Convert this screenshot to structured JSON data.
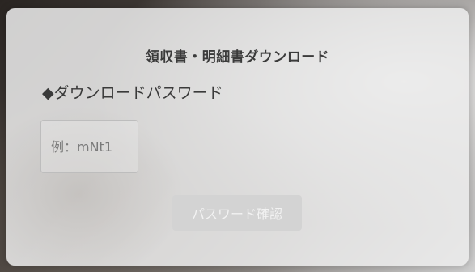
{
  "dialog": {
    "title": "領収書・明細書ダウンロード",
    "field_label": "◆ダウンロードパスワード",
    "password_placeholder": "例：mNt1",
    "password_value": "",
    "confirm_button_label": "パスワード確認"
  }
}
